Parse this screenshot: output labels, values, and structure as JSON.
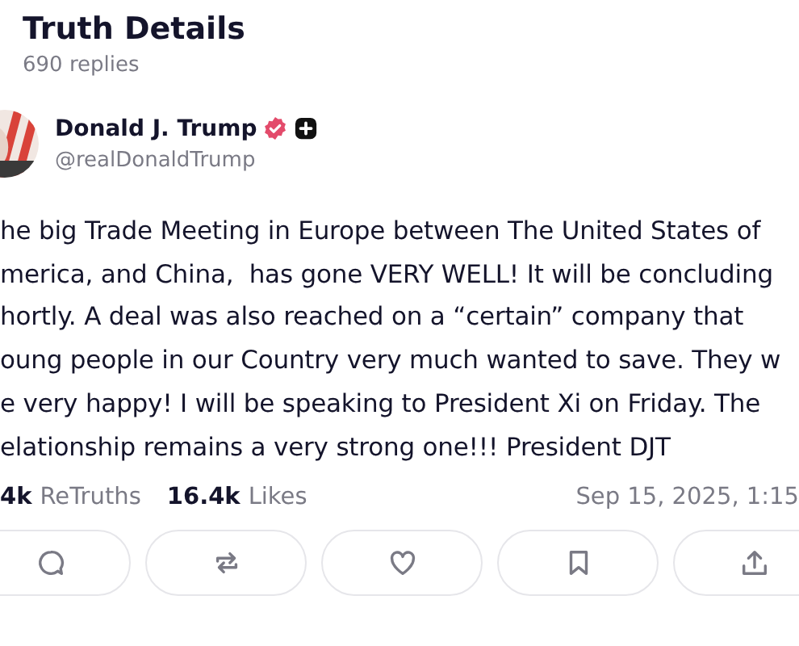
{
  "header": {
    "title": "Truth Details",
    "subtitle": "690 replies"
  },
  "author": {
    "name": "Donald J. Trump",
    "handle": "@realDonaldTrump",
    "verified": true,
    "plus": true
  },
  "body_lines": [
    "he big Trade Meeting in Europe between The United States of",
    "merica, and China,  has gone VERY WELL! It will be concluding",
    "hortly. A deal was also reached on a “certain” company that",
    "oung people in our Country very much wanted to save. They w",
    "e very happy! I will be speaking to President Xi on Friday. The",
    "elationship remains a very strong one!!! President DJT"
  ],
  "stats": [
    {
      "count": "4k",
      "label": "ReTruths"
    },
    {
      "count": "16.4k",
      "label": "Likes"
    }
  ],
  "timestamp": "Sep 15, 2025, 1:15",
  "actions": [
    {
      "kind": "reply"
    },
    {
      "kind": "retruth"
    },
    {
      "kind": "like"
    },
    {
      "kind": "bookmark"
    },
    {
      "kind": "share"
    }
  ]
}
